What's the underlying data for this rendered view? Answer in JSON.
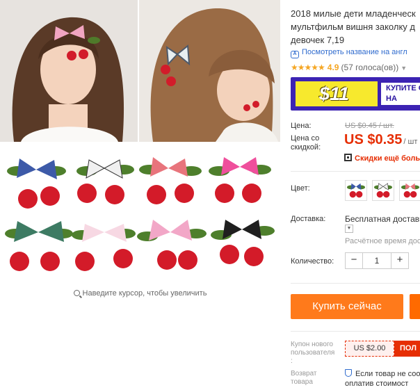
{
  "gallery": {
    "zoom_hint": "Наведите курсор, чтобы увеличить",
    "zoom_icon": "magnifier-icon"
  },
  "product": {
    "title": "2018 милые дети младенческ\nмультфильм вишня заколку д\nдевочек 7,19",
    "translate_link": "Посмотреть название на англ",
    "rating_value": "4.9",
    "votes": "(57 голоса(ов))",
    "stars": "★★★★★",
    "rating_fraction": 0.98
  },
  "banner": {
    "price": "$11",
    "cta": "КУПИТЕ С\nНА"
  },
  "pricing": {
    "price_label": "Цена:",
    "old_price": "US $0.45 / шт.",
    "discount_label": "Цена со\nскидкой:",
    "new_price": "US $0.35",
    "new_unit": "/ шт",
    "coupon_more": "Скидки ещё боль"
  },
  "options": {
    "color_label": "Цвет:",
    "shipping_label": "Доставка:",
    "shipping_method": "Бесплатная доставк",
    "shipping_time": "Расчётное время дос",
    "quantity_label": "Количество:",
    "quantity": "1",
    "minus": "−",
    "plus": "+"
  },
  "actions": {
    "buy_now": "Купить сейчас"
  },
  "coupon": {
    "label": "Купон нового\nпользователя\n:",
    "value": "US $2.00",
    "get": "ПОЛ"
  },
  "returns": {
    "label": "Возврат\nтовара",
    "text": "Если товар не соо\nоплатив стоимост"
  },
  "colors": {
    "accent": "#e62e04",
    "buy_button": "#ff7a1b",
    "link": "#2f6bce",
    "star": "#f5a623",
    "banner_bg": "#3c23b3",
    "banner_price_bg": "#f7e92d"
  }
}
